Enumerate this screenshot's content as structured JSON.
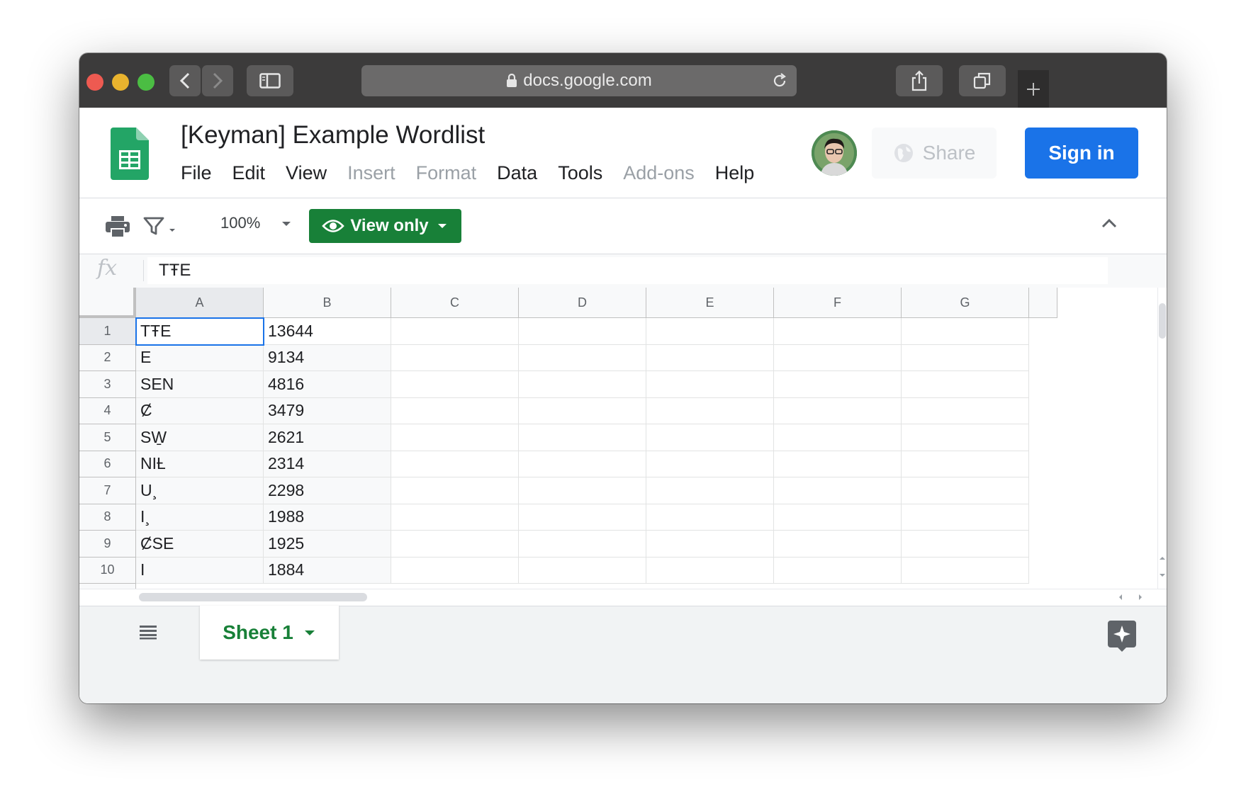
{
  "browser": {
    "url": "docs.google.com"
  },
  "app": {
    "doc_title": "[Keyman] Example Wordlist",
    "menu": [
      {
        "label": "File",
        "enabled": true
      },
      {
        "label": "Edit",
        "enabled": true
      },
      {
        "label": "View",
        "enabled": true
      },
      {
        "label": "Insert",
        "enabled": false
      },
      {
        "label": "Format",
        "enabled": false
      },
      {
        "label": "Data",
        "enabled": true
      },
      {
        "label": "Tools",
        "enabled": true
      },
      {
        "label": "Add-ons",
        "enabled": false
      },
      {
        "label": "Help",
        "enabled": true
      }
    ],
    "share_label": "Share",
    "signin_label": "Sign in"
  },
  "toolbar": {
    "zoom": "100%",
    "view_only_label": "View only"
  },
  "formula_bar": {
    "fx_label": "fx",
    "value": "TŦE"
  },
  "grid": {
    "columns": [
      "A",
      "B",
      "C",
      "D",
      "E",
      "F",
      "G"
    ],
    "rows": [
      {
        "num": "1",
        "a": "TŦE",
        "b": "13644"
      },
      {
        "num": "2",
        "a": "E",
        "b": "9134"
      },
      {
        "num": "3",
        "a": "SEN",
        "b": "4816"
      },
      {
        "num": "4",
        "a": "Ȼ",
        "b": "3479"
      },
      {
        "num": "5",
        "a": "SW̱",
        "b": "2621"
      },
      {
        "num": "6",
        "a": "NIȽ",
        "b": "2314"
      },
      {
        "num": "7",
        "a": "U¸",
        "b": "2298"
      },
      {
        "num": "8",
        "a": "I¸",
        "b": "1988"
      },
      {
        "num": "9",
        "a": "ȻSE",
        "b": "1925"
      },
      {
        "num": "10",
        "a": "I",
        "b": "1884"
      }
    ]
  },
  "sheets": {
    "active_tab": "Sheet 1"
  },
  "colors": {
    "sheets_green": "#188038",
    "signin_blue": "#1a73e8",
    "titlebar": "#3c3b3b"
  }
}
